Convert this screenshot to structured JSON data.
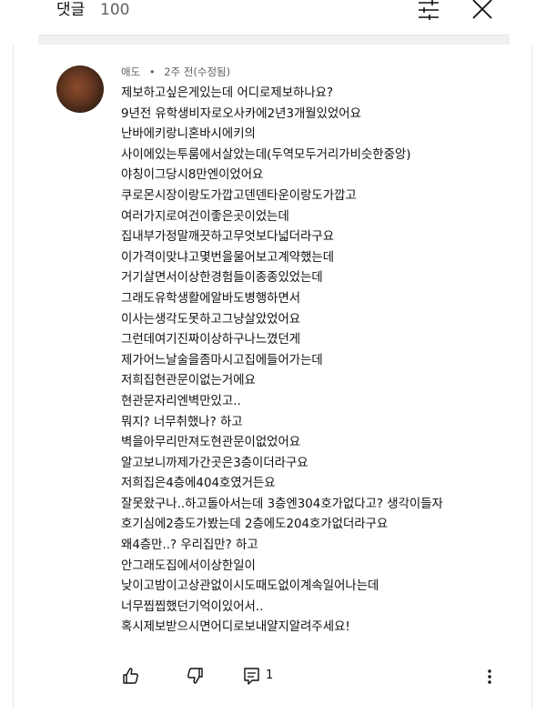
{
  "header": {
    "title": "댓글",
    "count": "100"
  },
  "comment": {
    "author": "애도",
    "separator": "•",
    "time": "2주 전(수정됨)",
    "lines": [
      "제보하고싶은게있는데 어디로제보하나요?",
      "9년전 유학생비자로오사카에2년3개월있었어요",
      "난바에키랑니혼바시에키의",
      "사이에있는투룸에서살았는데(두역모두거리가비슷한중앙)",
      "야칭이그당시8만엔이었어요",
      "쿠로몬시장이랑도가깝고덴덴타운이랑도가깝고",
      "여러가지로여건이좋은곳이었는데",
      "집내부가정말깨끗하고무엇보다넓더라구요",
      "이가격이맞냐고몇번을물어보고계약했는데",
      "거기살면서이상한경험들이종종있었는데",
      "그래도유학생활에알바도병행하면서",
      "이사는생각도못하고그냥살았었어요",
      "그런데여기진짜이상하구나느꼈던게",
      "제가어느날술을좀마시고집에들어가는데",
      "저희집현관문이없는거에요",
      "현관문자리엔벽만있고..",
      "뭐지? 너무취했나? 하고",
      "벽을아무리만져도현관문이없었어요",
      "알고보니까제가간곳은3층이더라구요",
      "저희집은4층에404호였거든요",
      "잘못왔구나..하고돌아서는데 3층엔304호가없다고? 생각이들자",
      "호기심에2층도가봤는데 2층에도204호가없더라구요",
      "왜4층만..? 우리집만? 하고",
      "안그래도집에서이상한일이",
      "낮이고밤이고상관없이시도때도없이계속일어나는데",
      "너무찝찝했던기억이있어서..",
      "혹시제보받으시면어디로보내얄지알려주세요!"
    ],
    "reply_count": "1"
  },
  "icons": {
    "filter": "sort-filter-icon",
    "close": "close-icon",
    "like": "thumbs-up-icon",
    "dislike": "thumbs-down-icon",
    "reply": "reply-icon",
    "more": "more-vertical-icon"
  },
  "colors": {
    "text": "#0f0f0f",
    "secondary": "#606060",
    "divider": "#f0f0f0"
  }
}
